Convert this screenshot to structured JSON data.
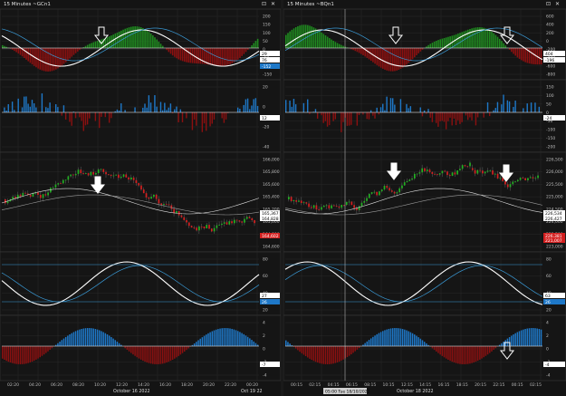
{
  "colors": {
    "bg": "#151515",
    "grid": "#2f2f2f",
    "green": "#1f8a1f",
    "red": "#8c1010",
    "blue": "#1e78c8",
    "white": "#ffffff",
    "cyan": "#3a9ad6",
    "zero": "#ffffff",
    "price_red": "#d42020"
  },
  "left": {
    "title": "15 Minutes ~GCn1",
    "osc1": {
      "ticks": [
        "200",
        "150",
        "100",
        "50",
        "0",
        "-50",
        "-100",
        "-150"
      ],
      "tags": [
        "29",
        "76",
        "-152"
      ]
    },
    "osc2": {
      "ticks": [
        "20",
        "0",
        "-20",
        "-40"
      ],
      "tags": [
        "12"
      ]
    },
    "price": {
      "ticks": [
        "166,000",
        "165,800",
        "165,600",
        "165,400",
        "165,200",
        "165,000",
        "164,800",
        "164,600"
      ],
      "tags": [
        "165,367",
        "164,828",
        "164,602"
      ]
    },
    "osc3": {
      "ticks": [
        "80",
        "60",
        "40",
        "20"
      ],
      "tags": [
        "27",
        "26"
      ]
    },
    "osc4": {
      "ticks": [
        "4",
        "2",
        "0",
        "-2",
        "-4"
      ],
      "tags": [
        "-7"
      ]
    },
    "xaxis": {
      "labels": [
        "02:20",
        "04:20",
        "06:20",
        "08:20",
        "10:20",
        "12:20",
        "14:20",
        "16:20",
        "18:20",
        "20:20",
        "22:20",
        "00:20"
      ],
      "date_main": "October 16 2022",
      "date_end": "Oct 19 22"
    }
  },
  "right": {
    "title": "15 Minutes ~BQn1",
    "osc1": {
      "ticks": [
        "600",
        "400",
        "200",
        "0",
        "-200",
        "-400",
        "-600",
        "-800"
      ],
      "tags": [
        "404",
        "-196"
      ]
    },
    "osc2": {
      "ticks": [
        "150",
        "100",
        "50",
        "0",
        "-50",
        "-100",
        "-150",
        "-200"
      ],
      "tags": [
        "-24"
      ]
    },
    "price": {
      "ticks": [
        "226,500",
        "226,000",
        "225,500",
        "225,000",
        "224,500",
        "224,000",
        "223,500",
        "223,000"
      ],
      "tags": [
        "226,534",
        "226,427",
        "226,381",
        "221,007"
      ]
    },
    "osc3": {
      "ticks": [
        "80",
        "60",
        "40",
        "20"
      ],
      "tags": [
        "63",
        "26"
      ]
    },
    "osc4": {
      "ticks": [
        "4",
        "2",
        "0",
        "-2",
        "-4"
      ],
      "tags": [
        "-4"
      ]
    },
    "xaxis": {
      "labels": [
        "00:15",
        "02:15",
        "04:15",
        "06:15",
        "08:15",
        "10:15",
        "12:15",
        "14:15",
        "16:15",
        "18:15",
        "20:15",
        "22:15",
        "00:15",
        "02:15"
      ],
      "date_main": "October 18 2022",
      "crosshair": "05:00 Tue 18/10/2022"
    }
  },
  "controls": {
    "zoom": "⊡",
    "close": "✕"
  }
}
